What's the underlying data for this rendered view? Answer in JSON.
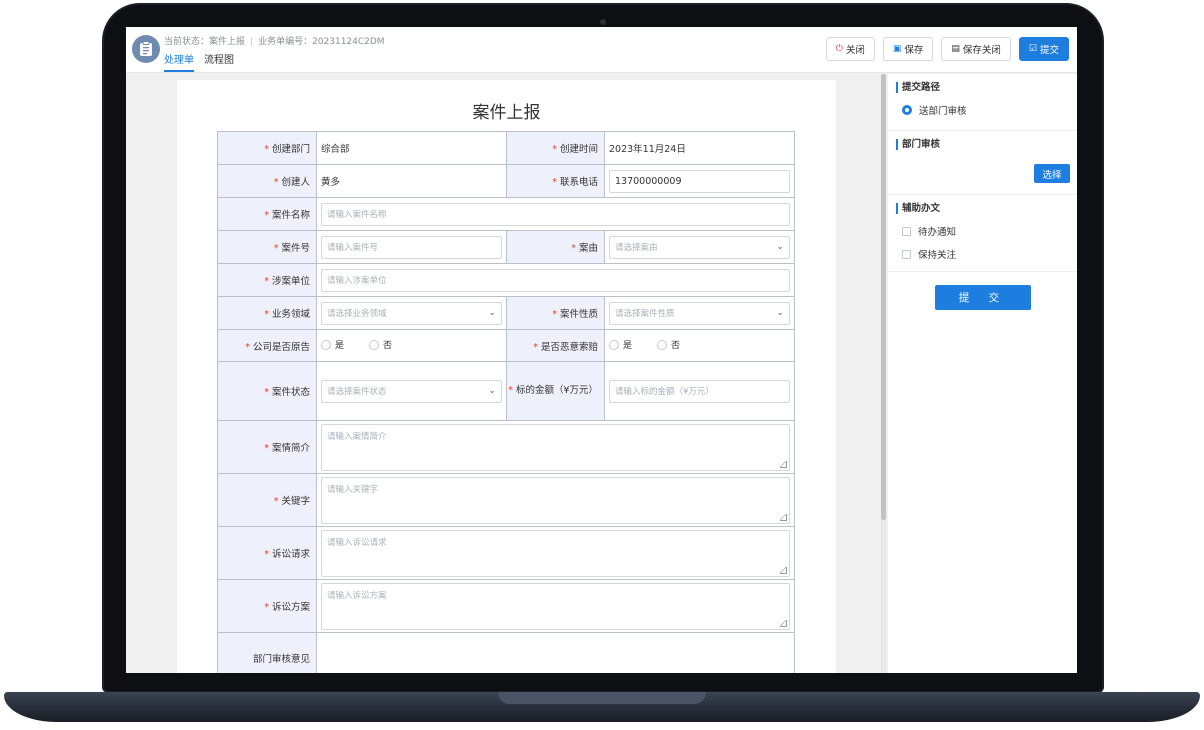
{
  "header": {
    "status_label": "当前状态：案件上报",
    "order_no_label": "业务单编号：20231124C2DM",
    "tabs": [
      "处理单",
      "流程图"
    ],
    "buttons": {
      "close": "关闭",
      "save": "保存",
      "save_close": "保存关闭",
      "submit": "提交"
    }
  },
  "form": {
    "title": "案件上报",
    "fields": {
      "dept": {
        "label": "创建部门",
        "value": "综合部"
      },
      "created_time": {
        "label": "创建时间",
        "value": "2023年11月24日"
      },
      "creator": {
        "label": "创建人",
        "value": "黄多"
      },
      "phone": {
        "label": "联系电话",
        "value": "13700000009"
      },
      "case_name": {
        "label": "案件名称",
        "placeholder": "请输入案件名称"
      },
      "case_no": {
        "label": "案件号",
        "placeholder": "请输入案件号"
      },
      "cause": {
        "label": "案由",
        "placeholder": "请选择案由"
      },
      "unit": {
        "label": "涉案单位",
        "placeholder": "请输入涉案单位"
      },
      "domain": {
        "label": "业务领域",
        "placeholder": "请选择业务领域"
      },
      "nature": {
        "label": "案件性质",
        "placeholder": "请选择案件性质"
      },
      "is_plaintiff": {
        "label": "公司是否原告",
        "yes": "是",
        "no": "否"
      },
      "malicious": {
        "label": "是否恶意索赔",
        "yes": "是",
        "no": "否"
      },
      "case_status": {
        "label": "案件状态",
        "placeholder": "请选择案件状态"
      },
      "amount": {
        "label": "标的金额（¥万元）",
        "placeholder": "请输入标的金额（¥万元）"
      },
      "summary": {
        "label": "案情简介",
        "placeholder": "请输入案情简介"
      },
      "keywords": {
        "label": "关键字",
        "placeholder": "请输入关键字"
      },
      "claims": {
        "label": "诉讼请求",
        "placeholder": "请输入诉讼请求"
      },
      "plan": {
        "label": "诉讼方案",
        "placeholder": "请输入诉讼方案"
      },
      "dept_opinion": {
        "label": "部门审核意见"
      }
    }
  },
  "panel": {
    "route_title": "提交路径",
    "route_option": "送部门审核",
    "review_title": "部门审核",
    "select_btn": "选择",
    "assist_title": "辅助办文",
    "assist_options": [
      "待办通知",
      "保持关注"
    ],
    "submit_btn": "提 交"
  }
}
